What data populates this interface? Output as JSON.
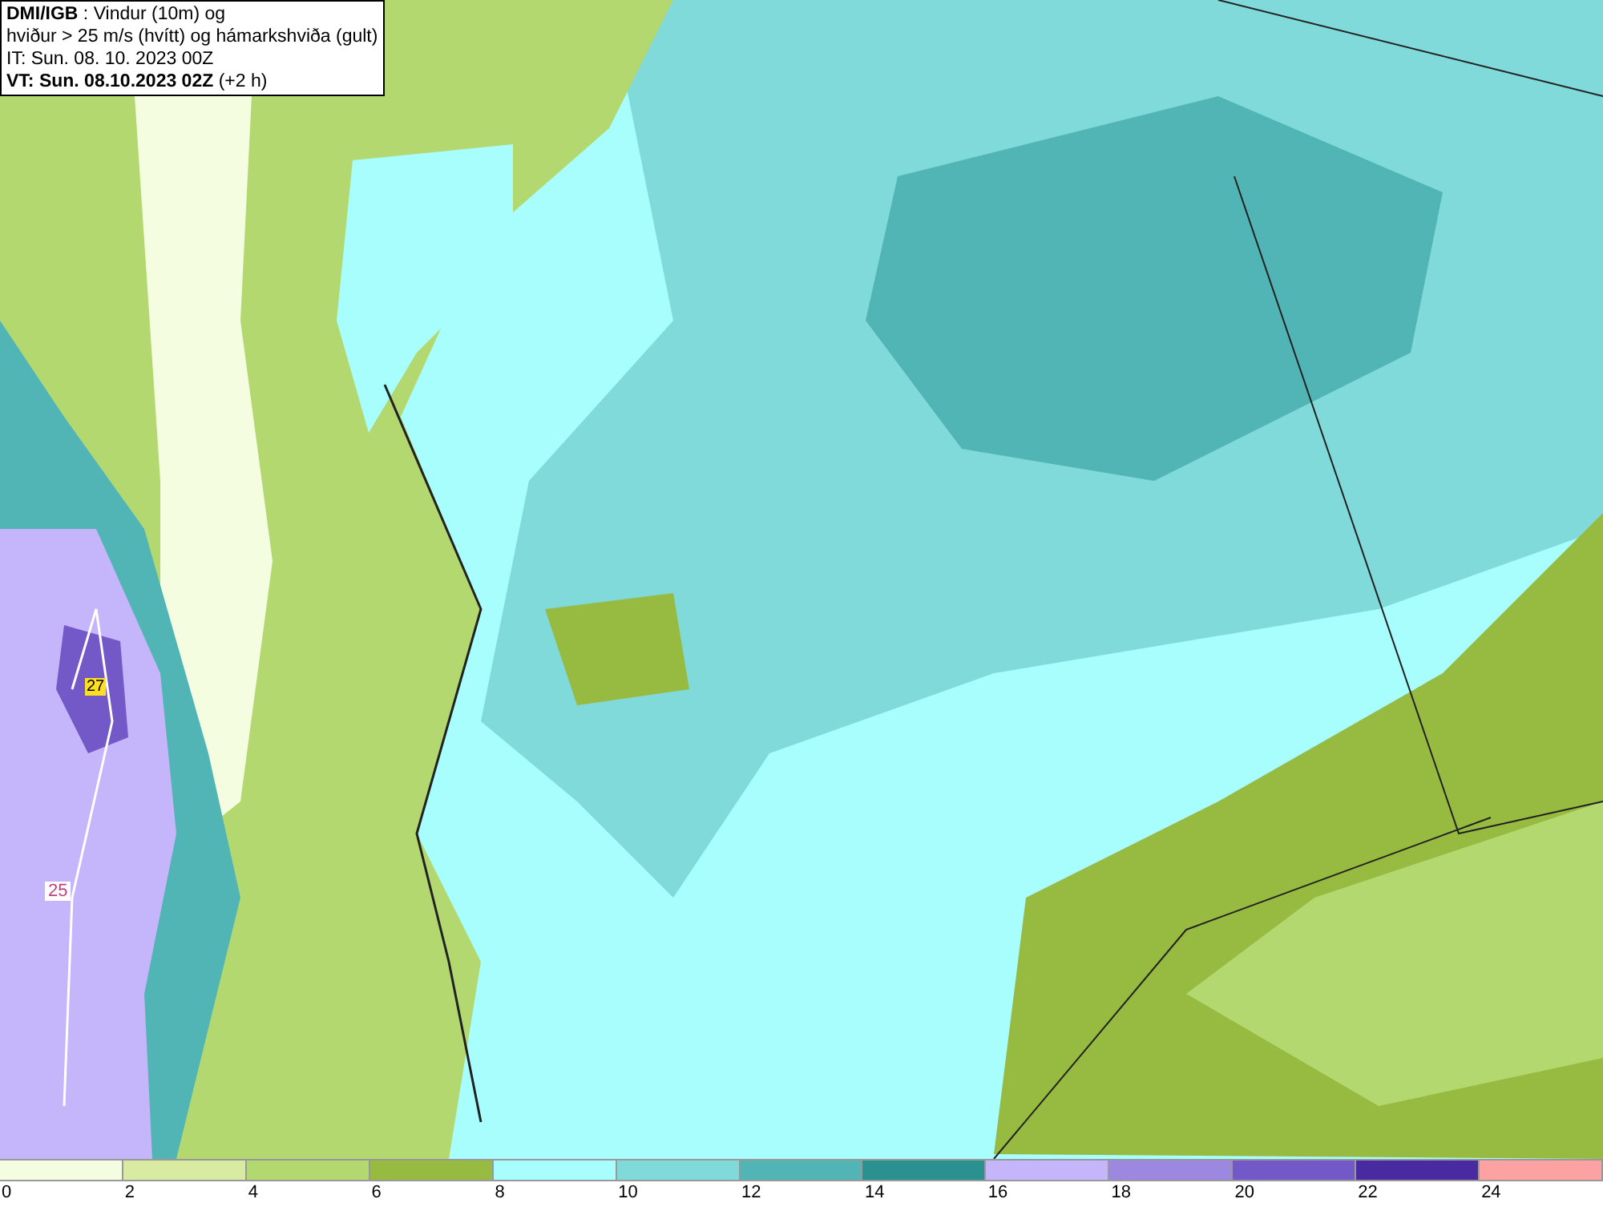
{
  "header": {
    "lines": [
      "**DMI/IGB** : Vindur (10m) og",
      "hviður > 25 m/s (hvítt) og hámarkshviða (gult)",
      "IT: Sun. 08. 10. 2023 00Z",
      "**VT: Sun. 08.10.2023 02Z** (+2 h)"
    ]
  },
  "map": {
    "labels": [
      {
        "text": "27",
        "kind": "max"
      },
      {
        "text": "25",
        "kind": "contour"
      }
    ]
  },
  "legend": [
    {
      "label": "0",
      "color": "#f5fde0"
    },
    {
      "label": "2",
      "color": "#d8eba0"
    },
    {
      "label": "4",
      "color": "#b3d870"
    },
    {
      "label": "6",
      "color": "#97bb40"
    },
    {
      "label": "8",
      "color": "#a8fdfd"
    },
    {
      "label": "10",
      "color": "#80dada"
    },
    {
      "label": "12",
      "color": "#52b5b5"
    },
    {
      "label": "14",
      "color": "#2a9090"
    },
    {
      "label": "16",
      "color": "#c5b5fa"
    },
    {
      "label": "18",
      "color": "#9c88e0"
    },
    {
      "label": "20",
      "color": "#7358c8"
    },
    {
      "label": "22",
      "color": "#4a2aa0"
    },
    {
      "label": "24",
      "color": "#fca2a2"
    }
  ]
}
